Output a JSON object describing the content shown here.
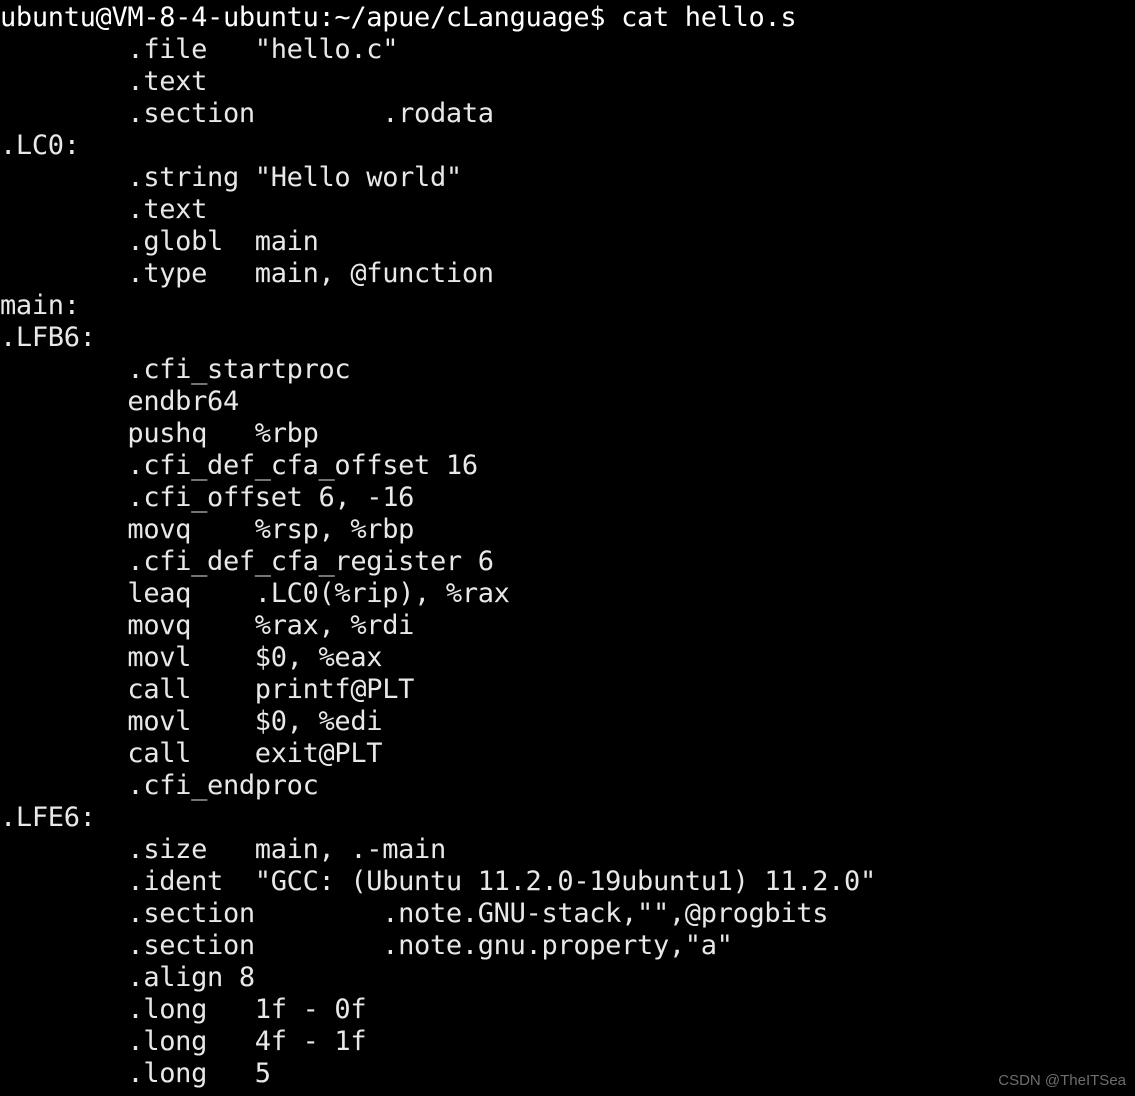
{
  "terminal": {
    "prompt": {
      "user": "ubuntu",
      "host": "VM-8-4-ubuntu",
      "path": "~/apue/cLanguage",
      "symbol": "$",
      "command": "cat hello.s",
      "full_line": "ubuntu@VM-8-4-ubuntu:~/apue/cLanguage$ cat hello.s"
    },
    "colors": {
      "background": "#000000",
      "foreground": "#e8e8e8",
      "prompt_foreground": "#ffffff",
      "watermark": "#6e6e6e"
    },
    "output_lines": [
      "        .file   \"hello.c\"",
      "        .text",
      "        .section        .rodata",
      ".LC0:",
      "        .string \"Hello world\"",
      "        .text",
      "        .globl  main",
      "        .type   main, @function",
      "main:",
      ".LFB6:",
      "        .cfi_startproc",
      "        endbr64",
      "        pushq   %rbp",
      "        .cfi_def_cfa_offset 16",
      "        .cfi_offset 6, -16",
      "        movq    %rsp, %rbp",
      "        .cfi_def_cfa_register 6",
      "        leaq    .LC0(%rip), %rax",
      "        movq    %rax, %rdi",
      "        movl    $0, %eax",
      "        call    printf@PLT",
      "        movl    $0, %edi",
      "        call    exit@PLT",
      "        .cfi_endproc",
      ".LFE6:",
      "        .size   main, .-main",
      "        .ident  \"GCC: (Ubuntu 11.2.0-19ubuntu1) 11.2.0\"",
      "        .section        .note.GNU-stack,\"\",@progbits",
      "        .section        .note.gnu.property,\"a\"",
      "        .align 8",
      "        .long   1f - 0f",
      "        .long   4f - 1f",
      "        .long   5"
    ]
  },
  "watermark": {
    "text": "CSDN @TheITSea"
  }
}
